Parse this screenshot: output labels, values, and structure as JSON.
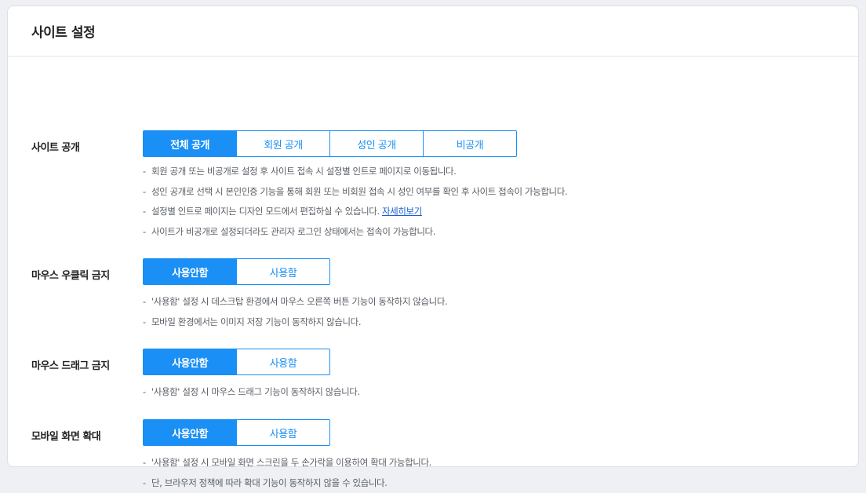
{
  "header": {
    "title": "사이트 설정"
  },
  "sections": [
    {
      "label": "사이트 공개",
      "options": [
        "전체 공개",
        "회원 공개",
        "성인 공개",
        "비공개"
      ],
      "selected": "전체 공개",
      "notes": [
        "회원 공개 또는 비공개로 설정 후 사이트 접속 시 설정별 인트로 페이지로 이동됩니다.",
        "성인 공개로 선택 시 본인인증 기능을 통해 회원 또는 비회원 접속 시 성인 여부를 확인 후 사이트 접속이 가능합니다.",
        "설정별 인트로 페이지는 디자인 모드에서 편집하실 수 있습니다.",
        "사이트가 비공개로 설정되더라도 관리자 로그인 상태에서는 접속이 가능합니다."
      ],
      "note_link": "자세히보기"
    },
    {
      "label": "마우스 우클릭 금지",
      "options": [
        "사용안함",
        "사용함"
      ],
      "selected": "사용안함",
      "notes": [
        "'사용함' 설정 시 데스크탑 환경에서 마우스 오른쪽 버튼 기능이 동작하지 않습니다.",
        "모바일 환경에서는 이미지 저장 기능이 동작하지 않습니다."
      ]
    },
    {
      "label": "마우스 드래그 금지",
      "options": [
        "사용안함",
        "사용함"
      ],
      "selected": "사용안함",
      "notes": [
        "'사용함' 설정 시 마우스 드래그 기능이 동작하지 않습니다."
      ]
    },
    {
      "label": "모바일 화면 확대",
      "options": [
        "사용안함",
        "사용함"
      ],
      "selected": "사용안함",
      "notes": [
        "'사용함' 설정 시 모바일 화면 스크린을 두 손가락을 이용하여 확대 가능합니다.",
        "단, 브라우저 정책에 따라 확대 기능이 동작하지 않을 수 있습니다."
      ]
    }
  ],
  "colors": {
    "accent": "#1a8ff5",
    "link": "#1a5fd0",
    "note_text": "#5a5f66"
  }
}
